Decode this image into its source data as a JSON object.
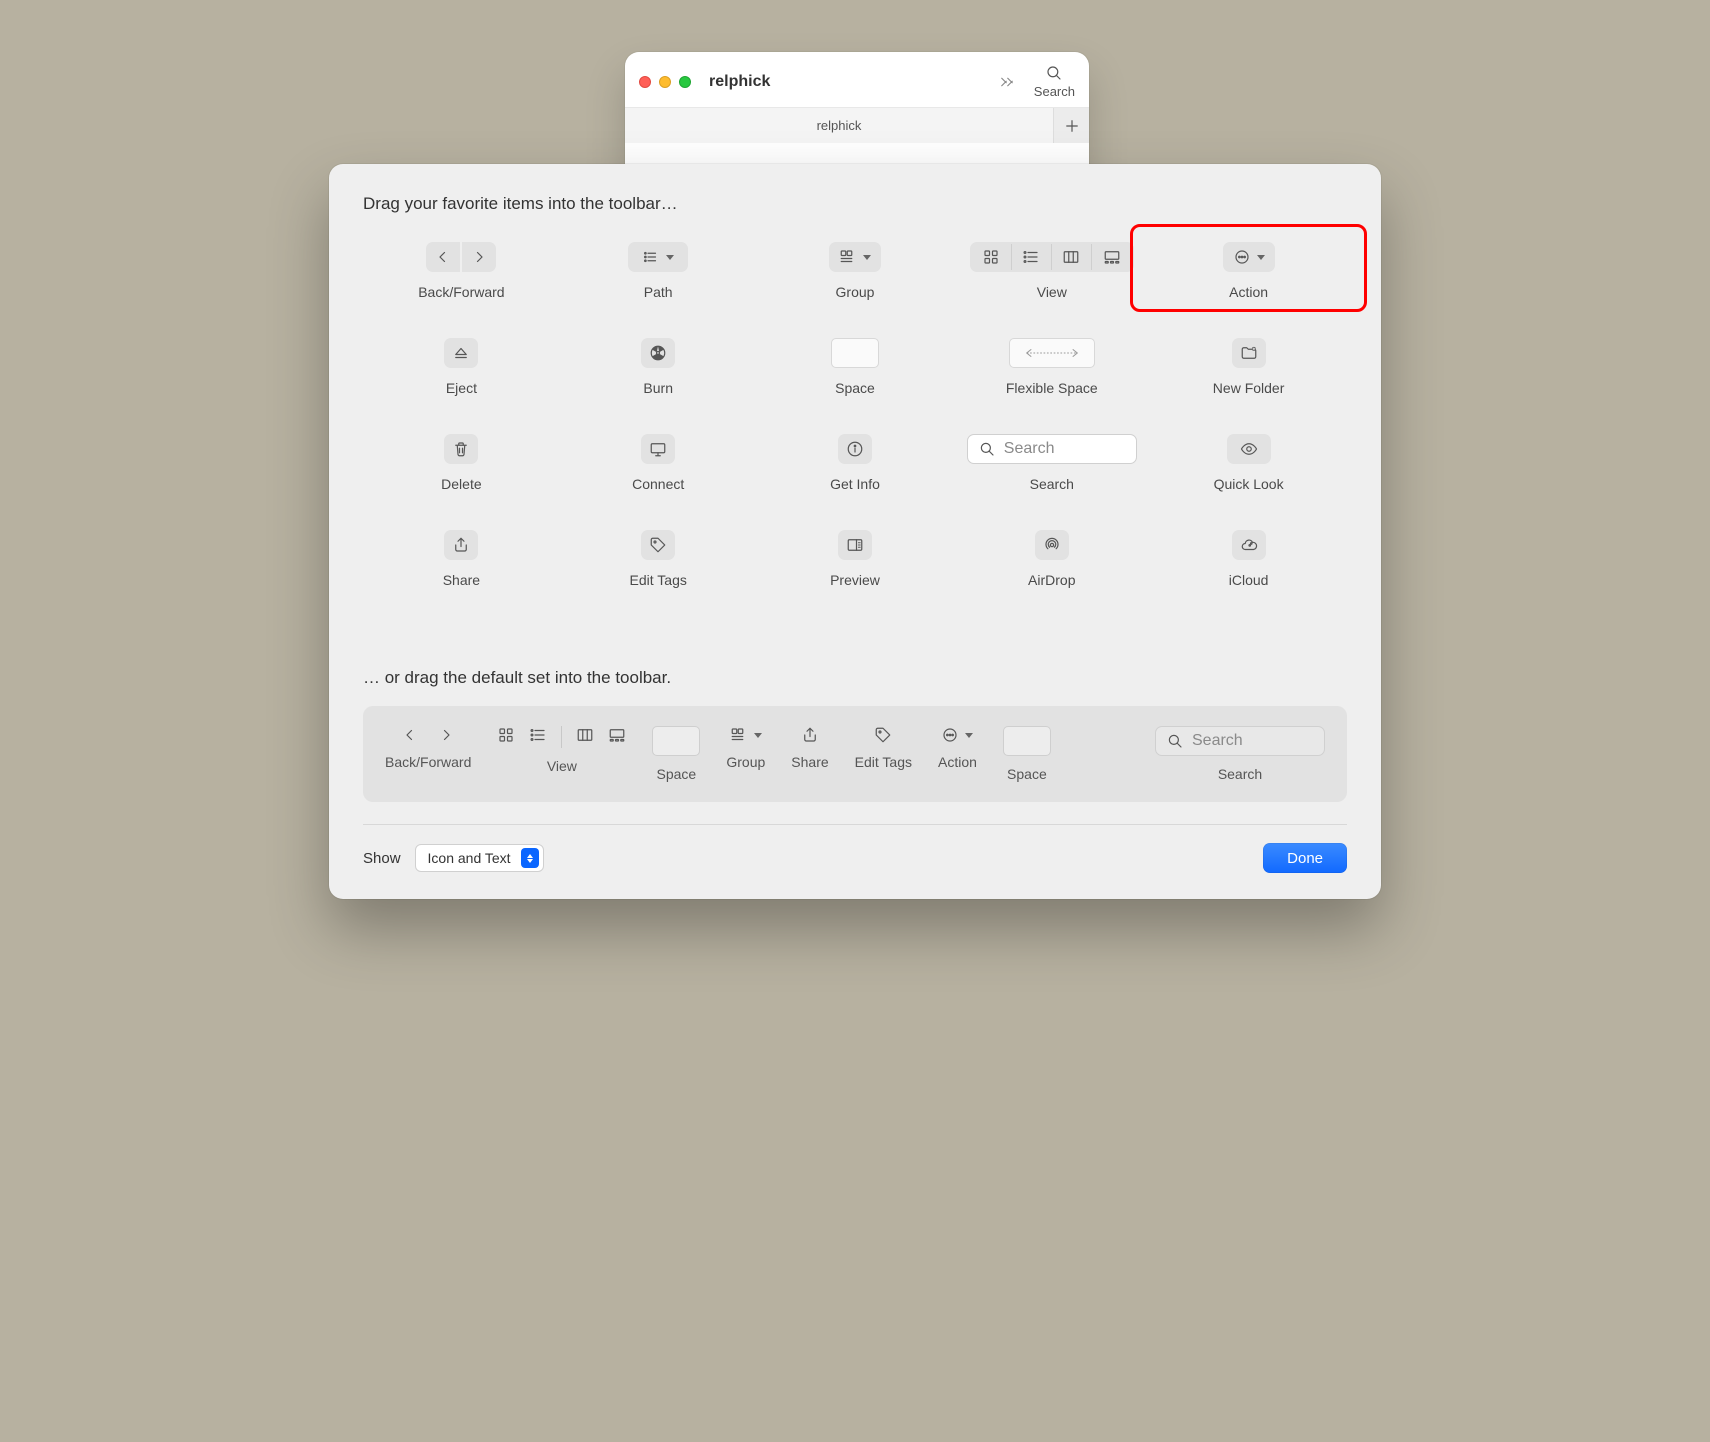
{
  "finder": {
    "title": "relphick",
    "search_label": "Search",
    "tab_title": "relphick"
  },
  "sheet": {
    "heading": "Drag your favorite items into the toolbar…",
    "heading2": "… or drag the default set into the toolbar."
  },
  "items": {
    "back_forward": "Back/Forward",
    "path": "Path",
    "group": "Group",
    "view": "View",
    "action": "Action",
    "eject": "Eject",
    "burn": "Burn",
    "space": "Space",
    "flexible_space": "Flexible Space",
    "new_folder": "New Folder",
    "delete": "Delete",
    "connect": "Connect",
    "get_info": "Get Info",
    "search": "Search",
    "quick_look": "Quick Look",
    "share": "Share",
    "edit_tags": "Edit Tags",
    "preview": "Preview",
    "airdrop": "AirDrop",
    "icloud": "iCloud"
  },
  "search_placeholder": "Search",
  "default_set": {
    "back_forward": "Back/Forward",
    "view": "View",
    "space1": "Space",
    "group": "Group",
    "share": "Share",
    "edit_tags": "Edit Tags",
    "action": "Action",
    "space2": "Space",
    "search": "Search"
  },
  "footer": {
    "show_label": "Show",
    "show_value": "Icon and Text",
    "done": "Done"
  },
  "highlight": "action"
}
